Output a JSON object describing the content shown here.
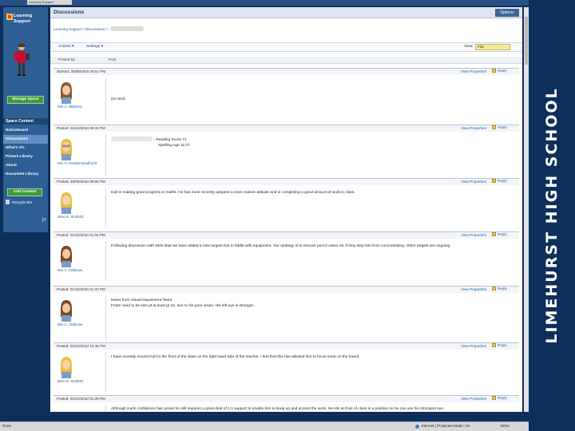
{
  "browser": {
    "tab_label": "Learning Support",
    "status": "Done",
    "zone": "Internet | Protected Mode: On",
    "zoom": "100%"
  },
  "banner": {
    "text": "LIMEHURST HIGH SCHOOL"
  },
  "sidebar": {
    "site_title": "Learning Support",
    "manage_space": "Manage Space",
    "space_content_header": "Space Content",
    "items": [
      {
        "label": "Noticeboard"
      },
      {
        "label": "Discussions"
      },
      {
        "label": "What's On"
      },
      {
        "label": "Picture Library"
      },
      {
        "label": "About"
      },
      {
        "label": "Document Library"
      }
    ],
    "add_content": "Add Content",
    "recycle_bin": "Recycle Bin",
    "collapse": "|<"
  },
  "page": {
    "title": "Discussions",
    "options": "Options",
    "breadcrumb": [
      "Learning Support",
      "Discussions"
    ],
    "toolbar": {
      "actions": "Actions",
      "settings": "Settings",
      "view_label": "View:",
      "view_value": "Flat"
    },
    "columns": {
      "posted_by": "Posted By",
      "post": "Post"
    },
    "view_properties": "View Properties",
    "reply": "Reply"
  },
  "posts": [
    {
      "date": "Started: 30/09/2010 08:51 PM",
      "author": "Mrs C. Blakeley",
      "body": [
        "(no text)"
      ]
    },
    {
      "date": "Posted: 01/10/2010 09:33 PM",
      "author": "Mrs H. Kewlett-Bradford3",
      "body": [
        "- Reading Score 71",
        "Spelling Age 11:07"
      ]
    },
    {
      "date": "Posted: 30/09/2010 09:56 PM",
      "author": "Miss M. Smith02",
      "body": [
        "Karl is making good progress in maths. He has more recently adopted a more mature attitude and is completing a good amount of work in class."
      ]
    },
    {
      "date": "Posted: 01/10/2010 01:04 PM",
      "author": "Mrs C. Oldknow",
      "body": [
        "Following discussion with SEN dept we have added a new targets Not to fiddle with equipment. Our strategy is to remove pencil cases etc if they stop him from concentrating. Other targets are ongoing."
      ]
    },
    {
      "date": "Posted: 01/10/2010 01:37 PM",
      "author": "Mrs C. Oldknow",
      "body": [
        "Notes from Visual Impairment Team:",
        "Fonts need to be size pt at least pt 22, due to his poor vision. His left eye is stronger."
      ]
    },
    {
      "date": "Posted: 02/10/2010 12:48 PM",
      "author": "Miss M. Smith02",
      "body": [
        "I have recently moved Karl to the front of the class on the right hand side of the teacher. I feel that this has allowed him to focus more on the board."
      ]
    },
    {
      "date": "Posted: 02/10/2010 01:28 PM",
      "author": "Miss M. Smith02",
      "body": [
        "Although Karls confidence has grown he still requires a great deal of 1:1 support to enable him to keep up and access the work. He sits at front of class in a position so he can use his strongest eye."
      ]
    }
  ],
  "colors": {
    "navy": "#0d2f5c",
    "nav_blue": "#2d5f94",
    "button_green": "#3c9a3c",
    "link": "#2a5d9a"
  }
}
